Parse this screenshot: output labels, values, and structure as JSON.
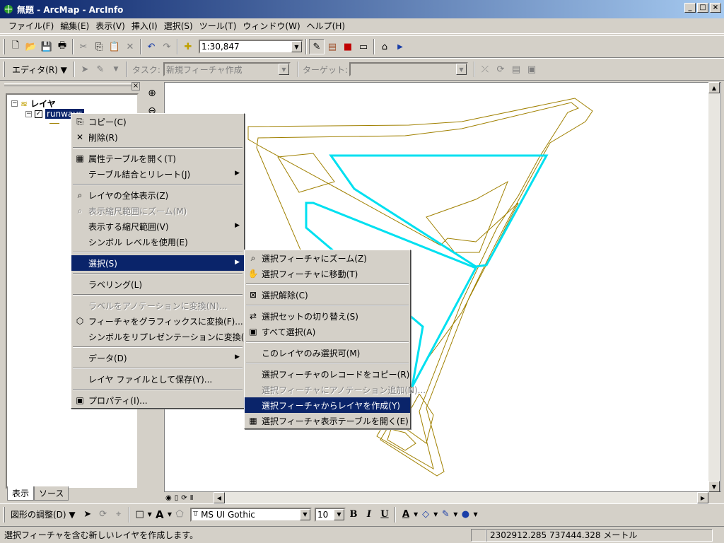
{
  "window": {
    "title": "無題 - ArcMap - ArcInfo",
    "min": "_",
    "max": "□",
    "close": "×"
  },
  "menubar": [
    "ファイル(F)",
    "編集(E)",
    "表示(V)",
    "挿入(I)",
    "選択(S)",
    "ツール(T)",
    "ウィンドウ(W)",
    "ヘルプ(H)"
  ],
  "standard_toolbar": {
    "scale": "1:30,847"
  },
  "editor_toolbar": {
    "editor_label": "エディタ(R) ▼",
    "task_label": "タスク:",
    "task_value": "新規フィーチャ作成",
    "target_label": "ターゲット:",
    "target_value": ""
  },
  "toc": {
    "root_label": "レイヤ",
    "layer_name": "runways",
    "tabs": [
      "表示",
      "ソース"
    ]
  },
  "context_menu": [
    {
      "label": "コピー(C)",
      "icon": "copy-icon",
      "enabled": true
    },
    {
      "label": "削除(R)",
      "icon": "delete-icon",
      "enabled": true
    },
    {
      "sep": true
    },
    {
      "label": "属性テーブルを開く(T)",
      "icon": "table-icon",
      "enabled": true
    },
    {
      "label": "テーブル結合とリレート(J)",
      "icon": "",
      "enabled": true,
      "submenu": true
    },
    {
      "sep": true
    },
    {
      "label": "レイヤの全体表示(Z)",
      "icon": "zoom-layer-icon",
      "enabled": true
    },
    {
      "label": "表示縮尺範囲にズーム(M)",
      "icon": "zoom-scale-icon",
      "enabled": false
    },
    {
      "label": "表示する縮尺範囲(V)",
      "icon": "",
      "enabled": true,
      "submenu": true
    },
    {
      "label": "シンボル レベルを使用(E)",
      "icon": "",
      "enabled": true
    },
    {
      "sep": true
    },
    {
      "label": "選択(S)",
      "icon": "",
      "enabled": true,
      "submenu": true,
      "selected": true
    },
    {
      "sep": true
    },
    {
      "label": "ラベリング(L)",
      "icon": "",
      "enabled": true
    },
    {
      "sep": true
    },
    {
      "label": "ラベルをアノテーションに変換(N)...",
      "icon": "",
      "enabled": false
    },
    {
      "label": "フィーチャをグラフィックスに変換(F)...",
      "icon": "convert-graphics-icon",
      "enabled": true
    },
    {
      "label": "シンボルをリプレゼンテーションに変換(B)...",
      "icon": "",
      "enabled": true
    },
    {
      "sep": true
    },
    {
      "label": "データ(D)",
      "icon": "",
      "enabled": true,
      "submenu": true
    },
    {
      "sep": true
    },
    {
      "label": "レイヤ ファイルとして保存(Y)...",
      "icon": "",
      "enabled": true
    },
    {
      "sep": true
    },
    {
      "label": "プロパティ(I)...",
      "icon": "properties-icon",
      "enabled": true
    }
  ],
  "submenu": [
    {
      "label": "選択フィーチャにズーム(Z)",
      "icon": "zoom-selected-icon",
      "enabled": true
    },
    {
      "label": "選択フィーチャに移動(T)",
      "icon": "pan-hand-icon",
      "enabled": true
    },
    {
      "sep": true
    },
    {
      "label": "選択解除(C)",
      "icon": "clear-selection-icon",
      "enabled": true
    },
    {
      "sep": true
    },
    {
      "label": "選択セットの切り替え(S)",
      "icon": "switch-selection-icon",
      "enabled": true
    },
    {
      "label": "すべて選択(A)",
      "icon": "select-all-icon",
      "enabled": true
    },
    {
      "sep": true
    },
    {
      "label": "このレイヤのみ選択可(M)",
      "icon": "",
      "enabled": true
    },
    {
      "sep": true
    },
    {
      "label": "選択フィーチャのレコードをコピー(R)",
      "icon": "",
      "enabled": true
    },
    {
      "label": "選択フィーチャにアノテーション追加(N)...",
      "icon": "",
      "enabled": false
    },
    {
      "label": "選択フィーチャからレイヤを作成(Y)",
      "icon": "",
      "enabled": true,
      "selected": true
    },
    {
      "label": "選択フィーチャ表示テーブルを開く(E)",
      "icon": "table-icon",
      "enabled": true
    }
  ],
  "draw_toolbar": {
    "label": "図形の調整(D) ▼",
    "font": "MS UI Gothic",
    "size": "10",
    "bold": "B",
    "italic": "I",
    "underline": "U"
  },
  "status": {
    "message": "選択フィーチャを含む新しいレイヤを作成します。",
    "coords": "2302912.285  737444.328 メートル"
  },
  "colors": {
    "selection": "#00e0f0",
    "feature": "#a08000",
    "highlight": "#0a246a"
  }
}
